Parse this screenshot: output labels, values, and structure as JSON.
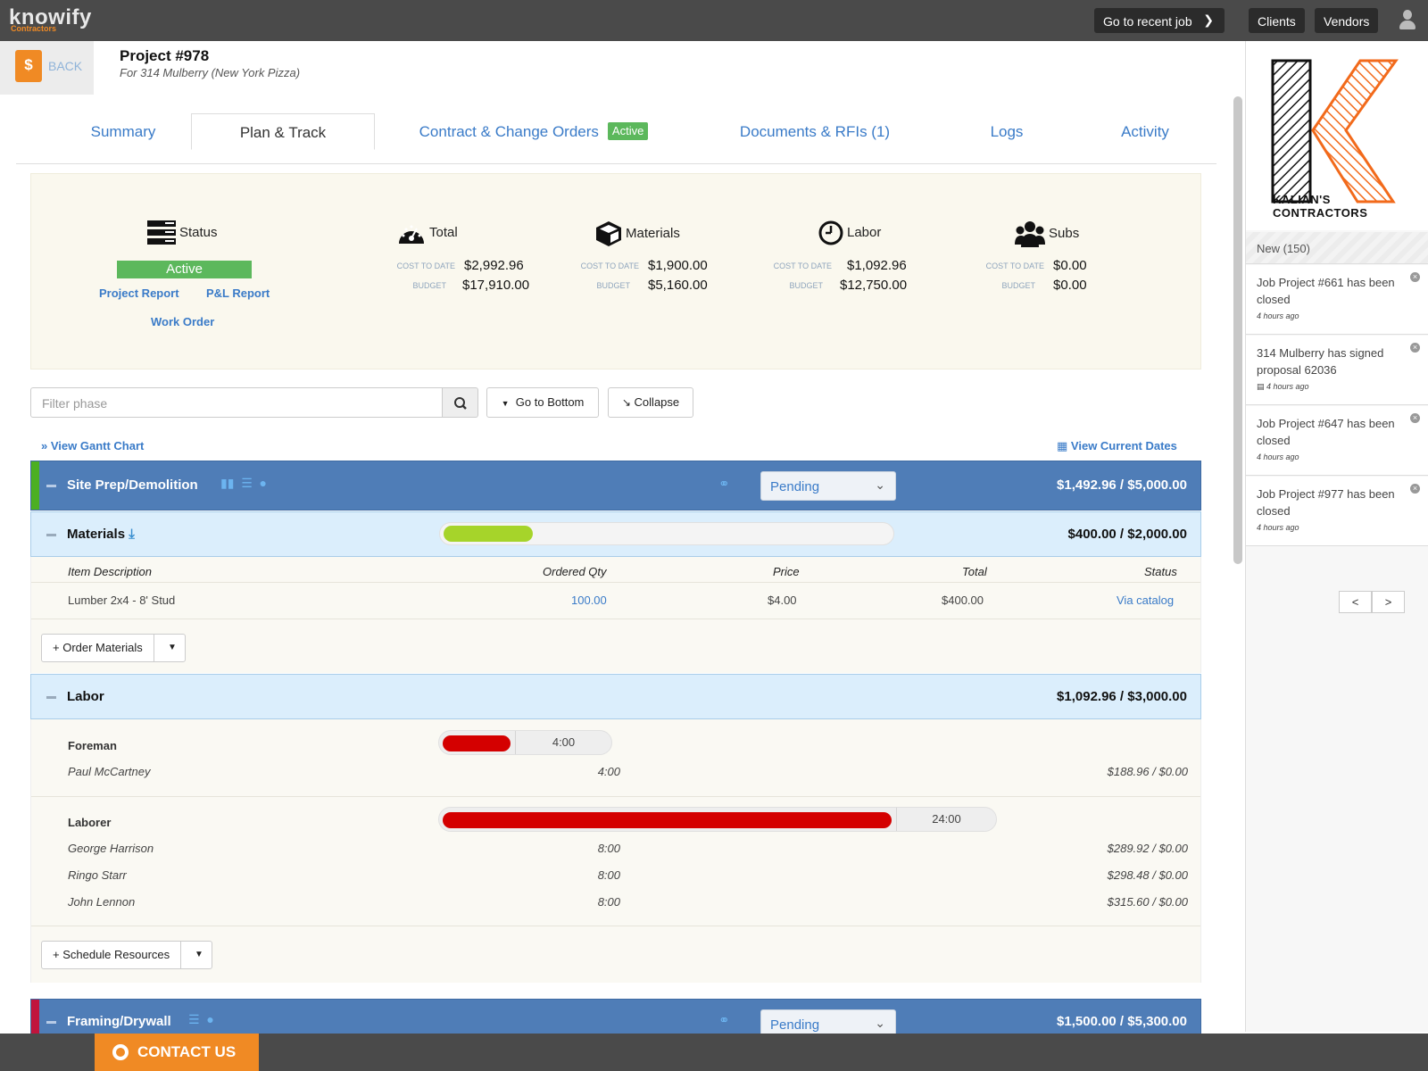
{
  "app": {
    "logo": "knowify",
    "logo_sub": "Contractors"
  },
  "topbar": {
    "recent_job": "Go to recent job",
    "clients": "Clients",
    "vendors": "Vendors"
  },
  "back": {
    "label": "BACK"
  },
  "project": {
    "title": "Project #978",
    "subtitle": "For 314 Mulberry (New York Pizza)"
  },
  "tabs": [
    {
      "label": "Summary"
    },
    {
      "label": "Plan & Track"
    },
    {
      "label": "Contract & Change Orders",
      "badge": "Active"
    },
    {
      "label": "Documents & RFIs (1)"
    },
    {
      "label": "Logs"
    },
    {
      "label": "Activity"
    }
  ],
  "summary": {
    "status": {
      "title": "Status",
      "value": "Active",
      "links": [
        "Project Report",
        "P&L Report",
        "Work Order"
      ]
    },
    "cost_to_date_label": "COST TO DATE",
    "budget_label": "BUDGET",
    "groups": [
      {
        "title": "Total",
        "icon": "dashboard-icon",
        "cost": "$2,992.96",
        "budget": "$17,910.00"
      },
      {
        "title": "Materials",
        "icon": "cube-icon",
        "cost": "$1,900.00",
        "budget": "$5,160.00"
      },
      {
        "title": "Labor",
        "icon": "clock-icon",
        "cost": "$1,092.96",
        "budget": "$12,750.00"
      },
      {
        "title": "Subs",
        "icon": "users-icon",
        "cost": "$0.00",
        "budget": "$0.00"
      }
    ]
  },
  "toolbar": {
    "filter_placeholder": "Filter phase",
    "go_bottom": "Go to Bottom",
    "collapse": "Collapse",
    "gantt": "View Gantt Chart",
    "current_dates": "View Current Dates"
  },
  "phases": [
    {
      "name": "Site Prep/Demolition",
      "status": "Pending",
      "amount": "$1,492.96 / $5,000.00",
      "stripe": "#4caf22"
    },
    {
      "name": "Framing/Drywall",
      "status": "Pending",
      "amount": "$1,500.00 / $5,300.00",
      "stripe": "#c0143c"
    }
  ],
  "materials": {
    "title": "Materials",
    "amount": "$400.00 / $2,000.00",
    "progress": 0.2,
    "headers": [
      "Item Description",
      "Ordered Qty",
      "Price",
      "Total",
      "Status"
    ],
    "rows": [
      {
        "desc": "Lumber 2x4 - 8' Stud",
        "qty": "100.00",
        "price": "$4.00",
        "total": "$400.00",
        "status": "Via catalog"
      }
    ],
    "order_btn": "+ Order Materials"
  },
  "labor": {
    "title": "Labor",
    "amount": "$1,092.96 / $3,000.00",
    "roles": [
      {
        "name": "Foreman",
        "hours": "4:00",
        "people": [
          {
            "name": "Paul McCartney",
            "hours": "4:00",
            "cost": "$188.96 / $0.00"
          }
        ]
      },
      {
        "name": "Laborer",
        "hours": "24:00",
        "people": [
          {
            "name": "George Harrison",
            "hours": "8:00",
            "cost": "$289.92 / $0.00"
          },
          {
            "name": "Ringo Starr",
            "hours": "8:00",
            "cost": "$298.48 / $0.00"
          },
          {
            "name": "John Lennon",
            "hours": "8:00",
            "cost": "$315.60 / $0.00"
          }
        ]
      }
    ],
    "schedule_btn": "+ Schedule Resources"
  },
  "notifications": {
    "header": "New (150)",
    "company": "KALIAN'S CONTRACTORS",
    "items": [
      {
        "text": "Job Project #661 has been closed",
        "time": "4 hours ago"
      },
      {
        "text": "314 Mulberry has signed proposal 62036",
        "time": "4 hours ago"
      },
      {
        "text": "Job Project #647 has been closed",
        "time": "4 hours ago"
      },
      {
        "text": "Job Project #977 has been closed",
        "time": "4 hours ago"
      }
    ],
    "prev": "<",
    "next": ">"
  },
  "footer": {
    "contact": "CONTACT US"
  },
  "colors": {
    "brand_orange": "#f08a24",
    "phase_blue": "#4f7db7",
    "link_blue": "#3a7bc8",
    "active_green": "#5cb85c",
    "labor_red": "#d40000",
    "progress_green": "#a6d42a"
  }
}
